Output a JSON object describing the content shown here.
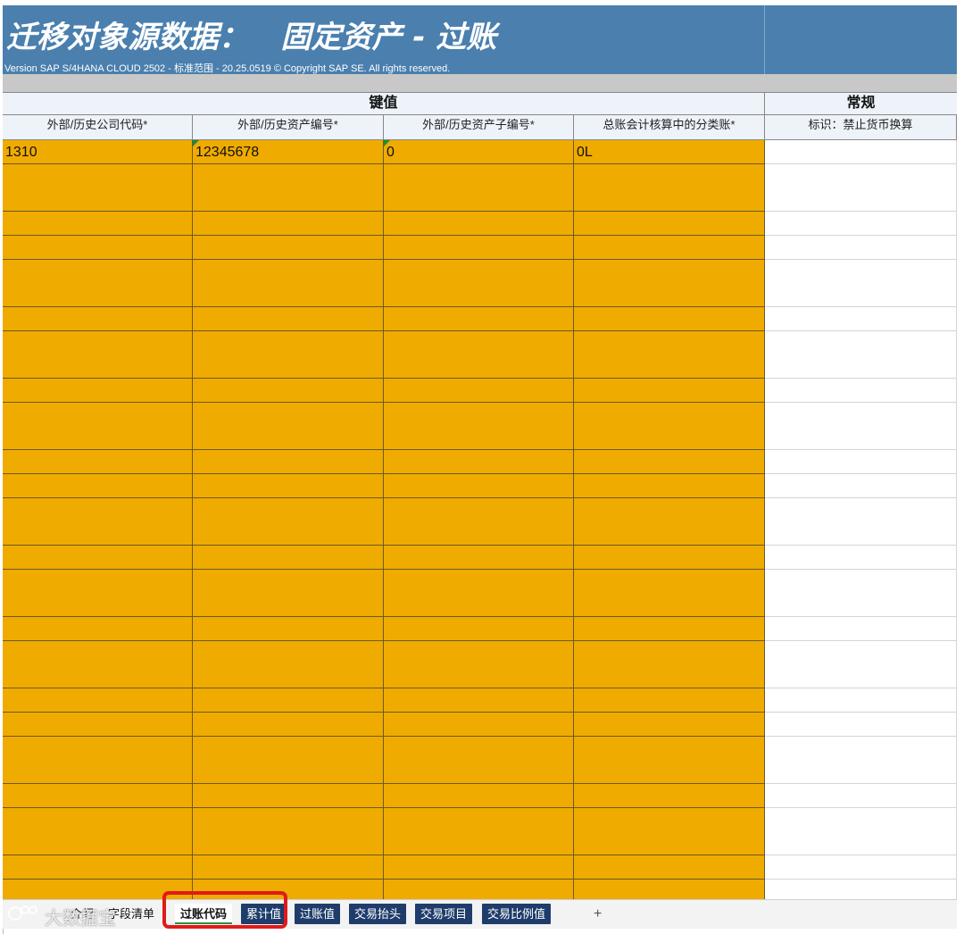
{
  "banner": {
    "title": "迁移对象源数据：   固定资产 - 过账",
    "version": "Version SAP S/4HANA CLOUD 2502 - 标准范围 - 20.25.0519 © Copyright SAP SE. All rights reserved."
  },
  "groups": {
    "key": "键值",
    "general": "常规"
  },
  "columns": [
    "外部/历史公司代码*",
    "外部/历史资产编号*",
    "外部/历史资产子编号*",
    "总账会计核算中的分类账*",
    "标识：禁止货币换算"
  ],
  "first_row": [
    "1310",
    "12345678",
    "0",
    "0L",
    ""
  ],
  "colors": {
    "banner": "#4a7fae",
    "key_cell": "#f0ab00",
    "dark_tab": "#1f3d6b",
    "highlight": "#e01a1a"
  },
  "tabs": {
    "intro": "介绍",
    "field_list": "字段清单",
    "posting_code": "过账代码",
    "cumulative": "累计值",
    "posted_values": "过账值",
    "trans_header": "交易抬头",
    "trans_items": "交易项目",
    "trans_ratio": "交易比例值",
    "add": "+"
  },
  "watermark": {
    "text": "大数据宝"
  }
}
